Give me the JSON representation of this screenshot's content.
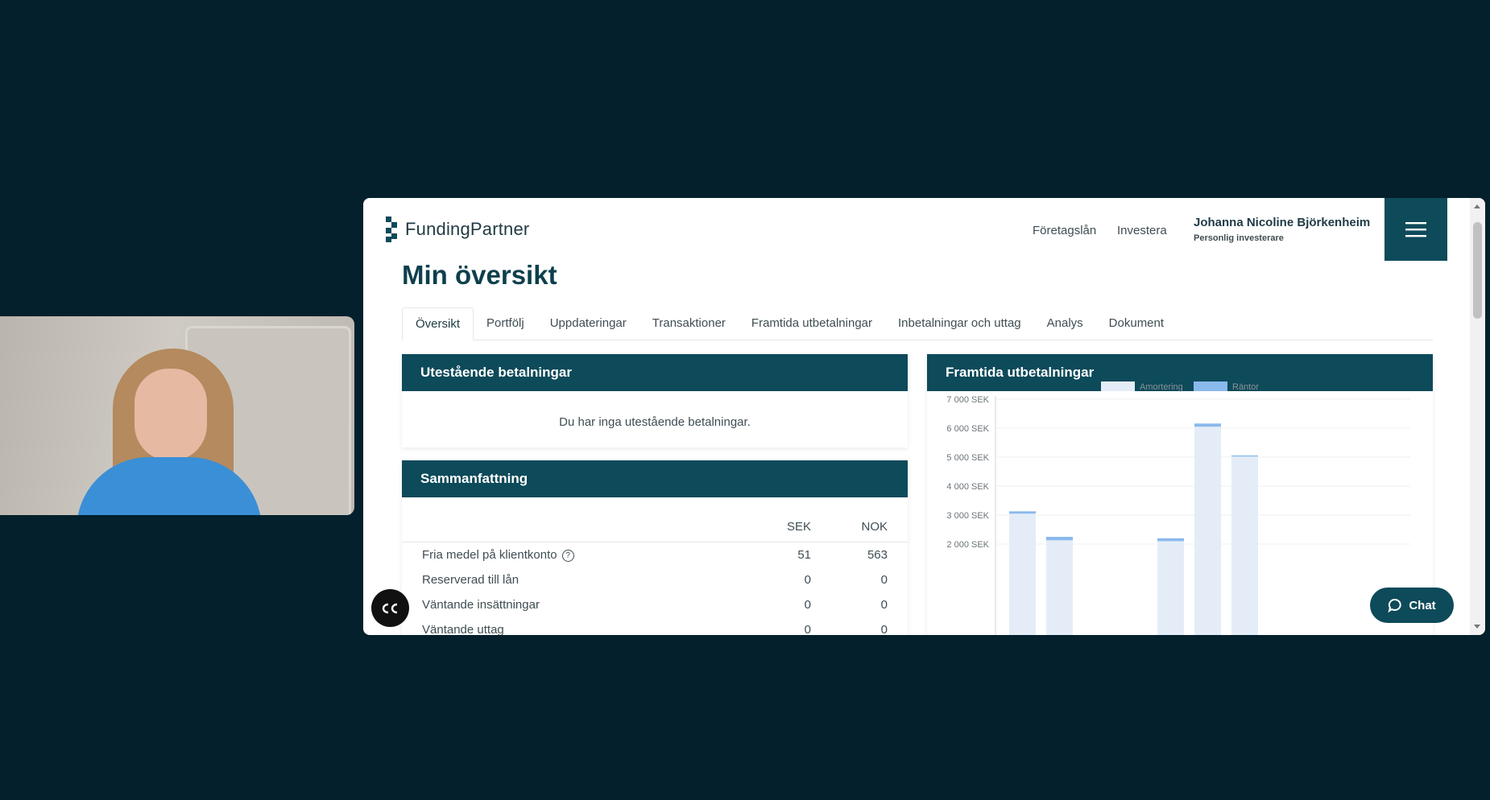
{
  "brand": {
    "name": "FundingPartner",
    "color": "#0d4a5a"
  },
  "nav": {
    "links": [
      "Företagslån",
      "Investera"
    ]
  },
  "user": {
    "name": "Johanna Nicoline Björkenheim",
    "role": "Personlig investerare"
  },
  "page": {
    "title": "Min översikt"
  },
  "tabs": [
    "Översikt",
    "Portfölj",
    "Uppdateringar",
    "Transaktioner",
    "Framtida utbetalningar",
    "Inbetalningar och uttag",
    "Analys",
    "Dokument"
  ],
  "outstanding": {
    "title": "Utestående betalningar",
    "empty_message": "Du har inga utestående betalningar."
  },
  "summary": {
    "title": "Sammanfattning",
    "columns": [
      "SEK",
      "NOK"
    ],
    "rows": [
      {
        "label": "Fria medel på klientkonto",
        "sek": "51",
        "nok": "563",
        "help": true
      },
      {
        "label": "Reserverad till lån",
        "sek": "0",
        "nok": "0"
      },
      {
        "label": "Väntande insättningar",
        "sek": "0",
        "nok": "0"
      },
      {
        "label": "Väntande uttag",
        "sek": "0",
        "nok": "0"
      }
    ]
  },
  "future": {
    "title": "Framtida utbetalningar"
  },
  "chart_data": {
    "type": "bar",
    "stacked": true,
    "ytick_labels": [
      "7 000 SEK",
      "6 000 SEK",
      "5 000 SEK",
      "4 000 SEK",
      "3 000 SEK",
      "2 000 SEK"
    ],
    "ylim": [
      2000,
      7000
    ],
    "legend_position": "top",
    "grid": true,
    "series": [
      {
        "name": "Amortering",
        "color": "#e4edf7",
        "values": [
          3050,
          2130,
          0,
          0,
          2100,
          6050,
          5020
        ]
      },
      {
        "name": "Räntor",
        "color": "#8ab9ec",
        "values": [
          80,
          120,
          0,
          0,
          100,
          110,
          40
        ]
      }
    ]
  },
  "chat": {
    "label": "Chat"
  },
  "icons": {
    "menu": "hamburger-icon",
    "cc": "closed-captions-icon",
    "chat": "chat-bubble-icon",
    "help": "question-circle-icon"
  }
}
